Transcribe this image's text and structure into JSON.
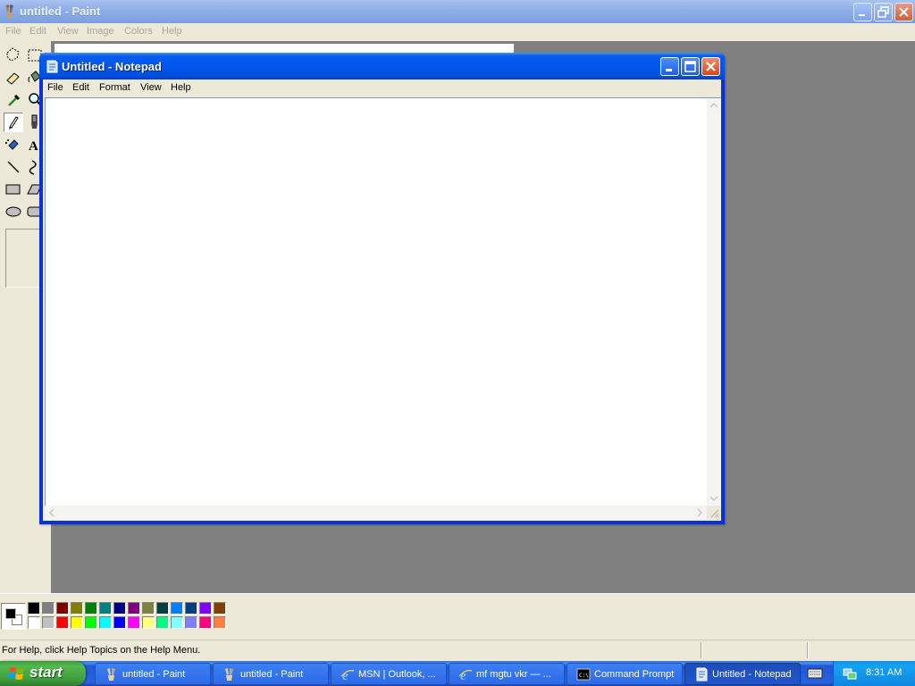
{
  "paint": {
    "title": "untitled - Paint",
    "menu": [
      "File",
      "Edit",
      "View",
      "Image",
      "Colors",
      "Help"
    ],
    "status_text": "For Help, click Help Topics on the Help Menu.",
    "palette_top": [
      "#000000",
      "#808080",
      "#800000",
      "#808000",
      "#008000",
      "#008080",
      "#000080",
      "#800080",
      "#808040",
      "#004040",
      "#0080ff",
      "#004080",
      "#8000ff",
      "#804000"
    ],
    "palette_bottom": [
      "#ffffff",
      "#c0c0c0",
      "#ff0000",
      "#ffff00",
      "#00ff00",
      "#00ffff",
      "#0000ff",
      "#ff00ff",
      "#ffff80",
      "#00ff80",
      "#80ffff",
      "#8080ff",
      "#ff0080",
      "#ff8040"
    ],
    "primary_color": "#000000",
    "secondary_color": "#ffffff",
    "tools": [
      "free-form-select-icon",
      "select-icon",
      "eraser-icon",
      "fill-icon",
      "color-picker-icon",
      "magnifier-icon",
      "pencil-icon",
      "brush-icon",
      "airbrush-icon",
      "text-icon",
      "line-icon",
      "curve-icon",
      "rectangle-icon",
      "polygon-icon",
      "ellipse-icon",
      "rounded-rectangle-icon"
    ],
    "selected_tool": "pencil-icon"
  },
  "notepad": {
    "title": "Untitled - Notepad",
    "menu": [
      "File",
      "Edit",
      "Format",
      "View",
      "Help"
    ],
    "text": ""
  },
  "taskbar": {
    "start_label": "start",
    "tasks": [
      {
        "label": "untitled - Paint",
        "icon": "paint-icon"
      },
      {
        "label": "untitled - Paint",
        "icon": "paint-icon"
      },
      {
        "label": "MSN | Outlook, ...",
        "icon": "internet-explorer-icon"
      },
      {
        "label": "mf mgtu vkr — ...",
        "icon": "internet-explorer-icon"
      },
      {
        "label": "Command Prompt",
        "icon": "command-prompt-icon"
      },
      {
        "label": "Untitled - Notepad",
        "icon": "notepad-icon",
        "active": true
      }
    ],
    "clock": "8:31 AM"
  },
  "colors": {
    "xp_blue": "#0054e3",
    "start_green": "#3c9a3c",
    "workspace_gray": "#808080",
    "window_face": "#ece9d8"
  }
}
